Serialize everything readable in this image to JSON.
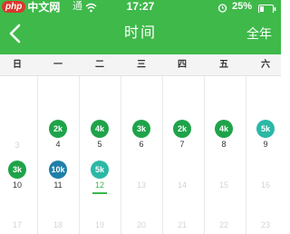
{
  "status_bar": {
    "logo_badge": "php",
    "logo_text": "中文网",
    "carrier": "通",
    "time": "17:27",
    "battery": "25%"
  },
  "nav": {
    "title": "时间",
    "year_button": "全年"
  },
  "weekdays": [
    "日",
    "一",
    "二",
    "三",
    "四",
    "五",
    "六"
  ],
  "days": {
    "d3": {
      "num": "3"
    },
    "d4": {
      "num": "4",
      "badge": "2k"
    },
    "d5": {
      "num": "5",
      "badge": "4k"
    },
    "d6": {
      "num": "6",
      "badge": "3k"
    },
    "d7": {
      "num": "7",
      "badge": "2k"
    },
    "d8": {
      "num": "8",
      "badge": "4k"
    },
    "d9": {
      "num": "9",
      "badge": "5k"
    },
    "d10": {
      "num": "10",
      "badge": "3k"
    },
    "d11": {
      "num": "11",
      "badge": "10k"
    },
    "d12": {
      "num": "12",
      "badge": "5k"
    },
    "d13": {
      "num": "13"
    },
    "d14": {
      "num": "14"
    },
    "d15": {
      "num": "15"
    },
    "d16": {
      "num": "16"
    },
    "d17": {
      "num": "17"
    },
    "d18": {
      "num": "18"
    },
    "d19": {
      "num": "19"
    },
    "d20": {
      "num": "20"
    },
    "d21": {
      "num": "21"
    },
    "d22": {
      "num": "22"
    },
    "d23": {
      "num": "23"
    }
  },
  "colors": {
    "header_green": "#3fb94a",
    "badge_green": "#1fa34a",
    "badge_blue": "#1f7fa8",
    "badge_teal": "#2bb8a6",
    "today_underline": "#38b84a"
  }
}
